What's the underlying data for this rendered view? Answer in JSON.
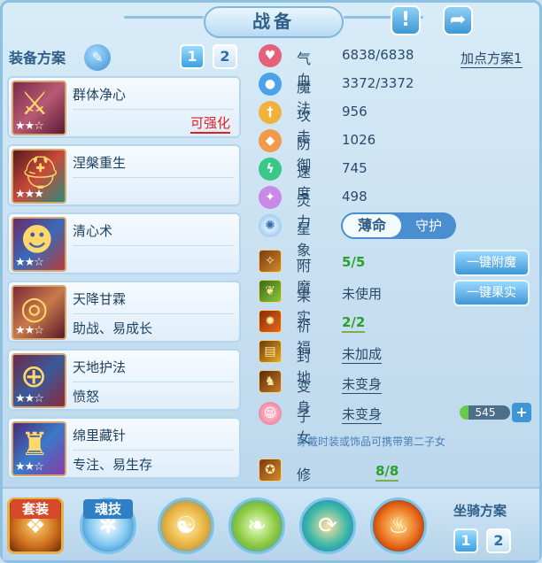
{
  "header": {
    "title": "战备",
    "alert_icon": "alert-icon",
    "share_icon": "share-icon"
  },
  "equip_panel": {
    "label": "装备方案",
    "plan_buttons": [
      "1",
      "2"
    ],
    "cards": [
      {
        "name": "群体净心",
        "sub": "",
        "action": "可强化",
        "stars": "★★☆",
        "icon": "weapon-icon"
      },
      {
        "name": "涅槃重生",
        "sub": "",
        "action": "",
        "stars": "★★★",
        "icon": "helmet-icon"
      },
      {
        "name": "清心术",
        "sub": "",
        "action": "",
        "stars": "★★☆",
        "icon": "mask-icon"
      },
      {
        "name": "天降甘霖",
        "sub": "助战、易成长",
        "action": "",
        "stars": "★★☆",
        "icon": "necklace-icon"
      },
      {
        "name": "天地护法",
        "sub": "愤怒",
        "action": "",
        "stars": "★★☆",
        "icon": "belt-icon"
      },
      {
        "name": "绵里藏针",
        "sub": "专注、易生存",
        "action": "",
        "stars": "★★☆",
        "icon": "armor-icon"
      }
    ]
  },
  "stats": {
    "plan_link": "加点方案1",
    "rows": [
      {
        "label": "气血",
        "value": "6838/6838",
        "icon": "heart-icon",
        "color": "#e5607a"
      },
      {
        "label": "魔法",
        "value": "3372/3372",
        "icon": "mana-icon",
        "color": "#4aa3e8"
      },
      {
        "label": "攻击",
        "value": "956",
        "icon": "sword-icon",
        "color": "#f0b23a"
      },
      {
        "label": "防御",
        "value": "1026",
        "icon": "shield-icon",
        "color": "#f09a4a"
      },
      {
        "label": "速度",
        "value": "745",
        "icon": "lightning-icon",
        "color": "#3ac88a"
      },
      {
        "label": "灵力",
        "value": "498",
        "icon": "spirit-icon",
        "color": "#c88ae6"
      }
    ],
    "star_label": "星象",
    "star_options": [
      "薄命",
      "守护"
    ]
  },
  "extras": {
    "rows": [
      {
        "label": "附魔",
        "value": "5/5",
        "icon": "enchant-icon"
      },
      {
        "label": "果实",
        "value": "未使用",
        "icon": "fruit-icon"
      },
      {
        "label": "祈福",
        "value": "2/2",
        "icon": "blessing-icon"
      },
      {
        "label": "封地",
        "value": "未加成",
        "icon": "fief-icon"
      },
      {
        "label": "变身",
        "value": "未变身",
        "icon": "transform-icon"
      },
      {
        "label": "子女",
        "value": "未变身",
        "icon": "child-icon"
      }
    ],
    "btn_enchant": "一键附魔",
    "btn_fruit": "一键果实",
    "pet_value": "545",
    "note": "穿戴时装或饰品可携带第二子女",
    "awaken_label": "修炼觉醒",
    "awaken_value": "8/8"
  },
  "bottom": {
    "tab_set": "套装",
    "tab_soul": "魂技",
    "mount_label": "坐骑方案",
    "mount_buttons": [
      "1",
      "2"
    ]
  }
}
